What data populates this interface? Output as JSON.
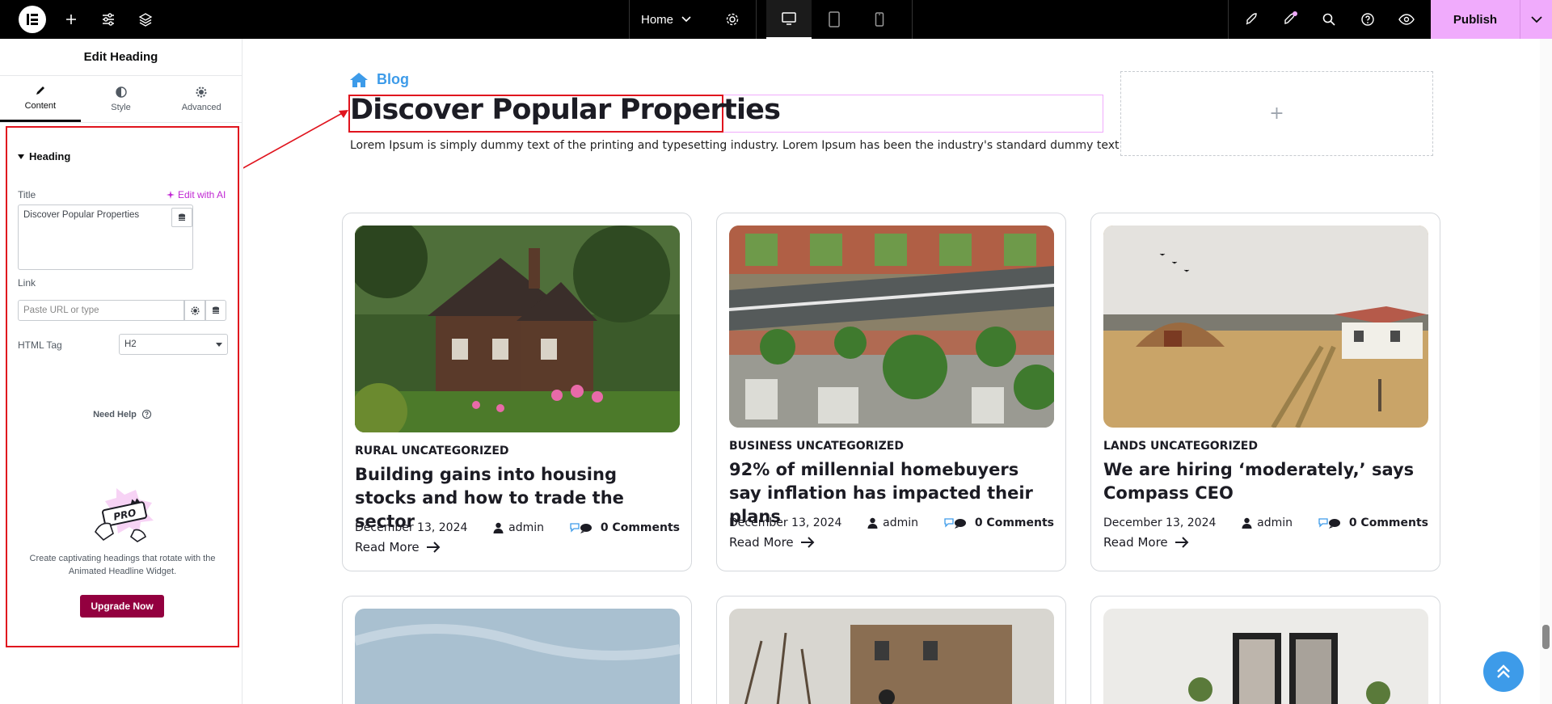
{
  "topbar": {
    "page_name": "Home",
    "publish_label": "Publish",
    "accent_color": "#f0abfc"
  },
  "panel": {
    "title": "Edit Heading",
    "tabs": [
      {
        "label": "Content",
        "icon": "pencil-icon",
        "active": true
      },
      {
        "label": "Style",
        "icon": "half-circle-icon",
        "active": false
      },
      {
        "label": "Advanced",
        "icon": "gear-icon",
        "active": false
      }
    ],
    "section_title": "Heading",
    "title_label": "Title",
    "edit_ai_label": "Edit with AI",
    "title_value": "Discover Popular Properties",
    "link_label": "Link",
    "link_placeholder": "Paste URL or type",
    "html_tag_label": "HTML Tag",
    "html_tag_value": "H2",
    "need_help": "Need Help",
    "pro_badge": "PRO",
    "promo_text": "Create captivating headings that rotate with the Animated Headline Widget.",
    "upgrade_label": "Upgrade Now"
  },
  "canvas": {
    "breadcrumb": "Blog",
    "heading": "Discover Popular Properties",
    "lorem": "Lorem Ipsum is simply dummy text of the printing and typesetting industry. Lorem Ipsum has been the industry's standard dummy text",
    "cards": [
      {
        "category": "RURAL UNCATEGORIZED",
        "title": "Building gains into housing stocks and how to trade the sector",
        "date": "December 13, 2024",
        "author": "admin",
        "comments": "0 Comments",
        "read_more": "Read More"
      },
      {
        "category": "BUSINESS UNCATEGORIZED",
        "title": "92% of millennial homebuyers say inflation has impacted their plans",
        "date": "December 13, 2024",
        "author": "admin",
        "comments": "0 Comments",
        "read_more": "Read More"
      },
      {
        "category": "LANDS UNCATEGORIZED",
        "title": "We are hiring ‘moderately,’ says Compass CEO",
        "date": "December 13, 2024",
        "author": "admin",
        "comments": "0 Comments",
        "read_more": "Read More"
      }
    ]
  }
}
